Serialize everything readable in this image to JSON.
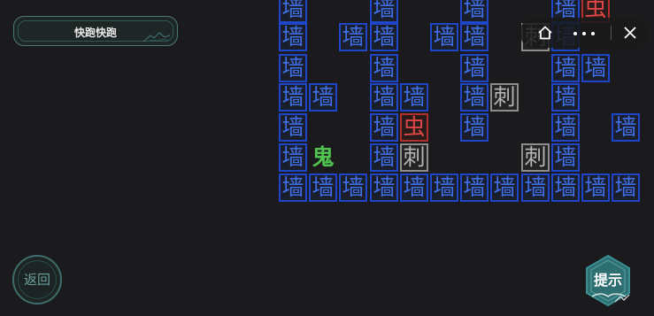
{
  "header": {
    "title": "快跑快跑"
  },
  "buttons": {
    "back_label": "返回",
    "hint_label": "提示"
  },
  "miniprogram_bar": {
    "home_icon": "home-icon",
    "more_icon": "more-dots-icon",
    "close_icon": "close-icon"
  },
  "colors": {
    "wall": "#3f6fe6",
    "spike": "#b5b5b5",
    "worm": "#e04646",
    "ghost": "#4fc24f",
    "background": "#1b1b1d"
  },
  "board": {
    "rows": [
      [
        "墙",
        "",
        "",
        "墙",
        "",
        "",
        "墙",
        "",
        "",
        "墙",
        "虫",
        ""
      ],
      [
        "墙",
        "",
        "墙",
        "墙",
        "",
        "墙",
        "墙",
        "",
        "刺",
        "墙",
        "",
        ""
      ],
      [
        "墙",
        "",
        "",
        "墙",
        "",
        "",
        "墙",
        "",
        "",
        "墙",
        "墙",
        ""
      ],
      [
        "墙",
        "墙",
        "",
        "墙",
        "墙",
        "",
        "墙",
        "刺",
        "",
        "墙",
        "",
        ""
      ],
      [
        "墙",
        "",
        "",
        "墙",
        "虫",
        "",
        "墙",
        "",
        "",
        "墙",
        "",
        "墙"
      ],
      [
        "墙",
        "鬼",
        "",
        "墙",
        "刺",
        "",
        "",
        "",
        "刺",
        "墙",
        "",
        ""
      ],
      [
        "墙",
        "墙",
        "墙",
        "墙",
        "墙",
        "墙",
        "墙",
        "墙",
        "墙",
        "墙",
        "墙",
        "墙"
      ]
    ],
    "types": {
      "墙": "wall",
      "刺": "spike",
      "虫": "worm",
      "鬼": "ghost"
    }
  }
}
